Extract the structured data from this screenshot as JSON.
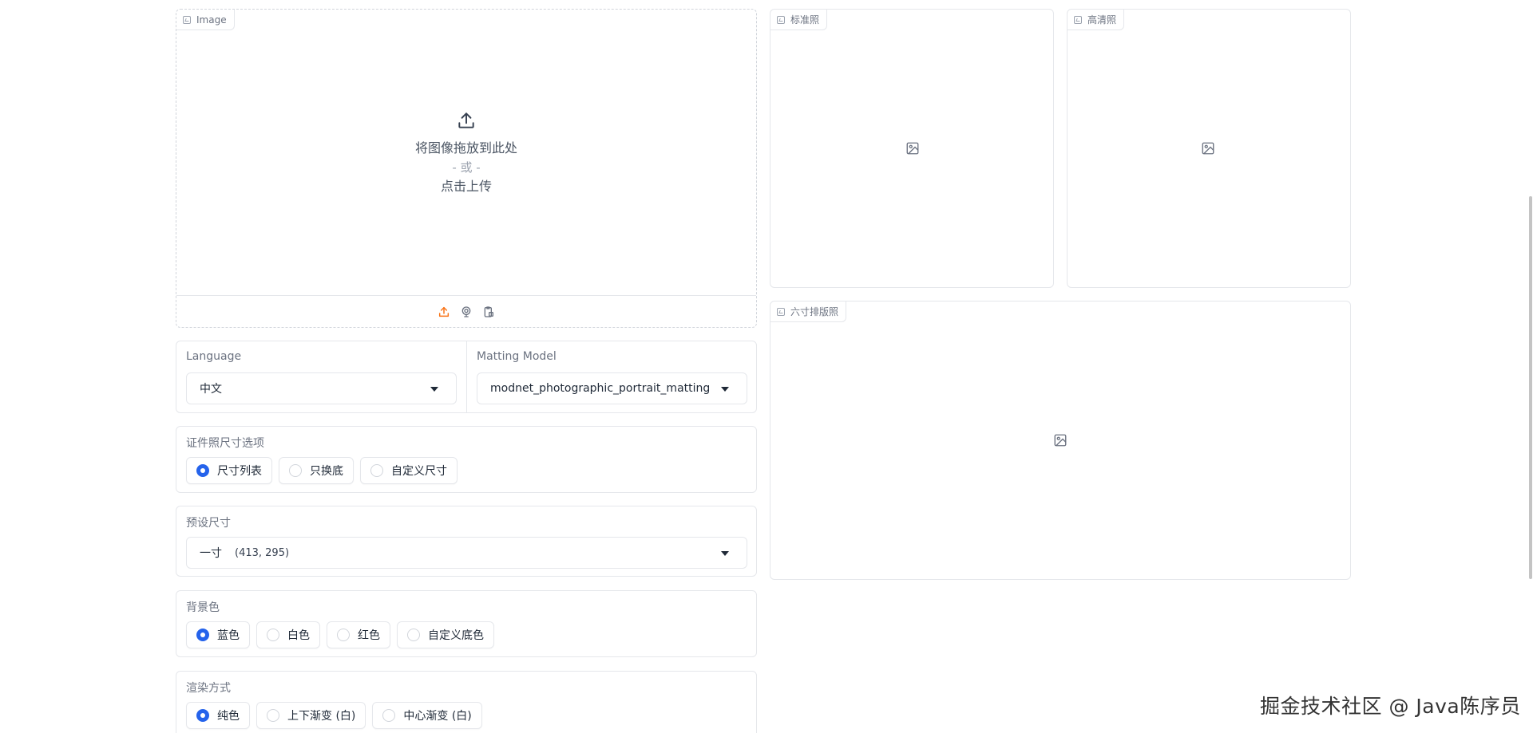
{
  "image_input": {
    "tag": "Image",
    "drop_text": "将图像拖放到此处",
    "or_text": "- 或 -",
    "click_text": "点击上传",
    "sources": [
      "upload-icon",
      "webcam-icon",
      "clipboard-icon"
    ],
    "accent": "#f97316"
  },
  "outputs": {
    "standard": {
      "tag": "标准照"
    },
    "hd": {
      "tag": "高清照"
    },
    "six_inch": {
      "tag": "六寸排版照"
    }
  },
  "language": {
    "label": "Language",
    "value": "中文"
  },
  "matting_model": {
    "label": "Matting Model",
    "value": "modnet_photographic_portrait_matting"
  },
  "size_option": {
    "label": "证件照尺寸选项",
    "options": [
      {
        "label": "尺寸列表",
        "selected": true
      },
      {
        "label": "只换底",
        "selected": false
      },
      {
        "label": "自定义尺寸",
        "selected": false
      }
    ]
  },
  "preset_size": {
    "label": "预设尺寸",
    "name": "一寸",
    "dims": "(413, 295)"
  },
  "background_color": {
    "label": "背景色",
    "options": [
      {
        "label": "蓝色",
        "selected": true
      },
      {
        "label": "白色",
        "selected": false
      },
      {
        "label": "红色",
        "selected": false
      },
      {
        "label": "自定义底色",
        "selected": false
      }
    ]
  },
  "render_mode": {
    "label": "渲染方式",
    "options": [
      {
        "label": "纯色",
        "selected": true
      },
      {
        "label": "上下渐变 (白)",
        "selected": false
      },
      {
        "label": "中心渐变 (白)",
        "selected": false
      }
    ]
  },
  "watermark": "掘金技术社区 @ Java陈序员",
  "colors": {
    "selected_radio": "#2563eb",
    "border": "#e5e7eb"
  }
}
